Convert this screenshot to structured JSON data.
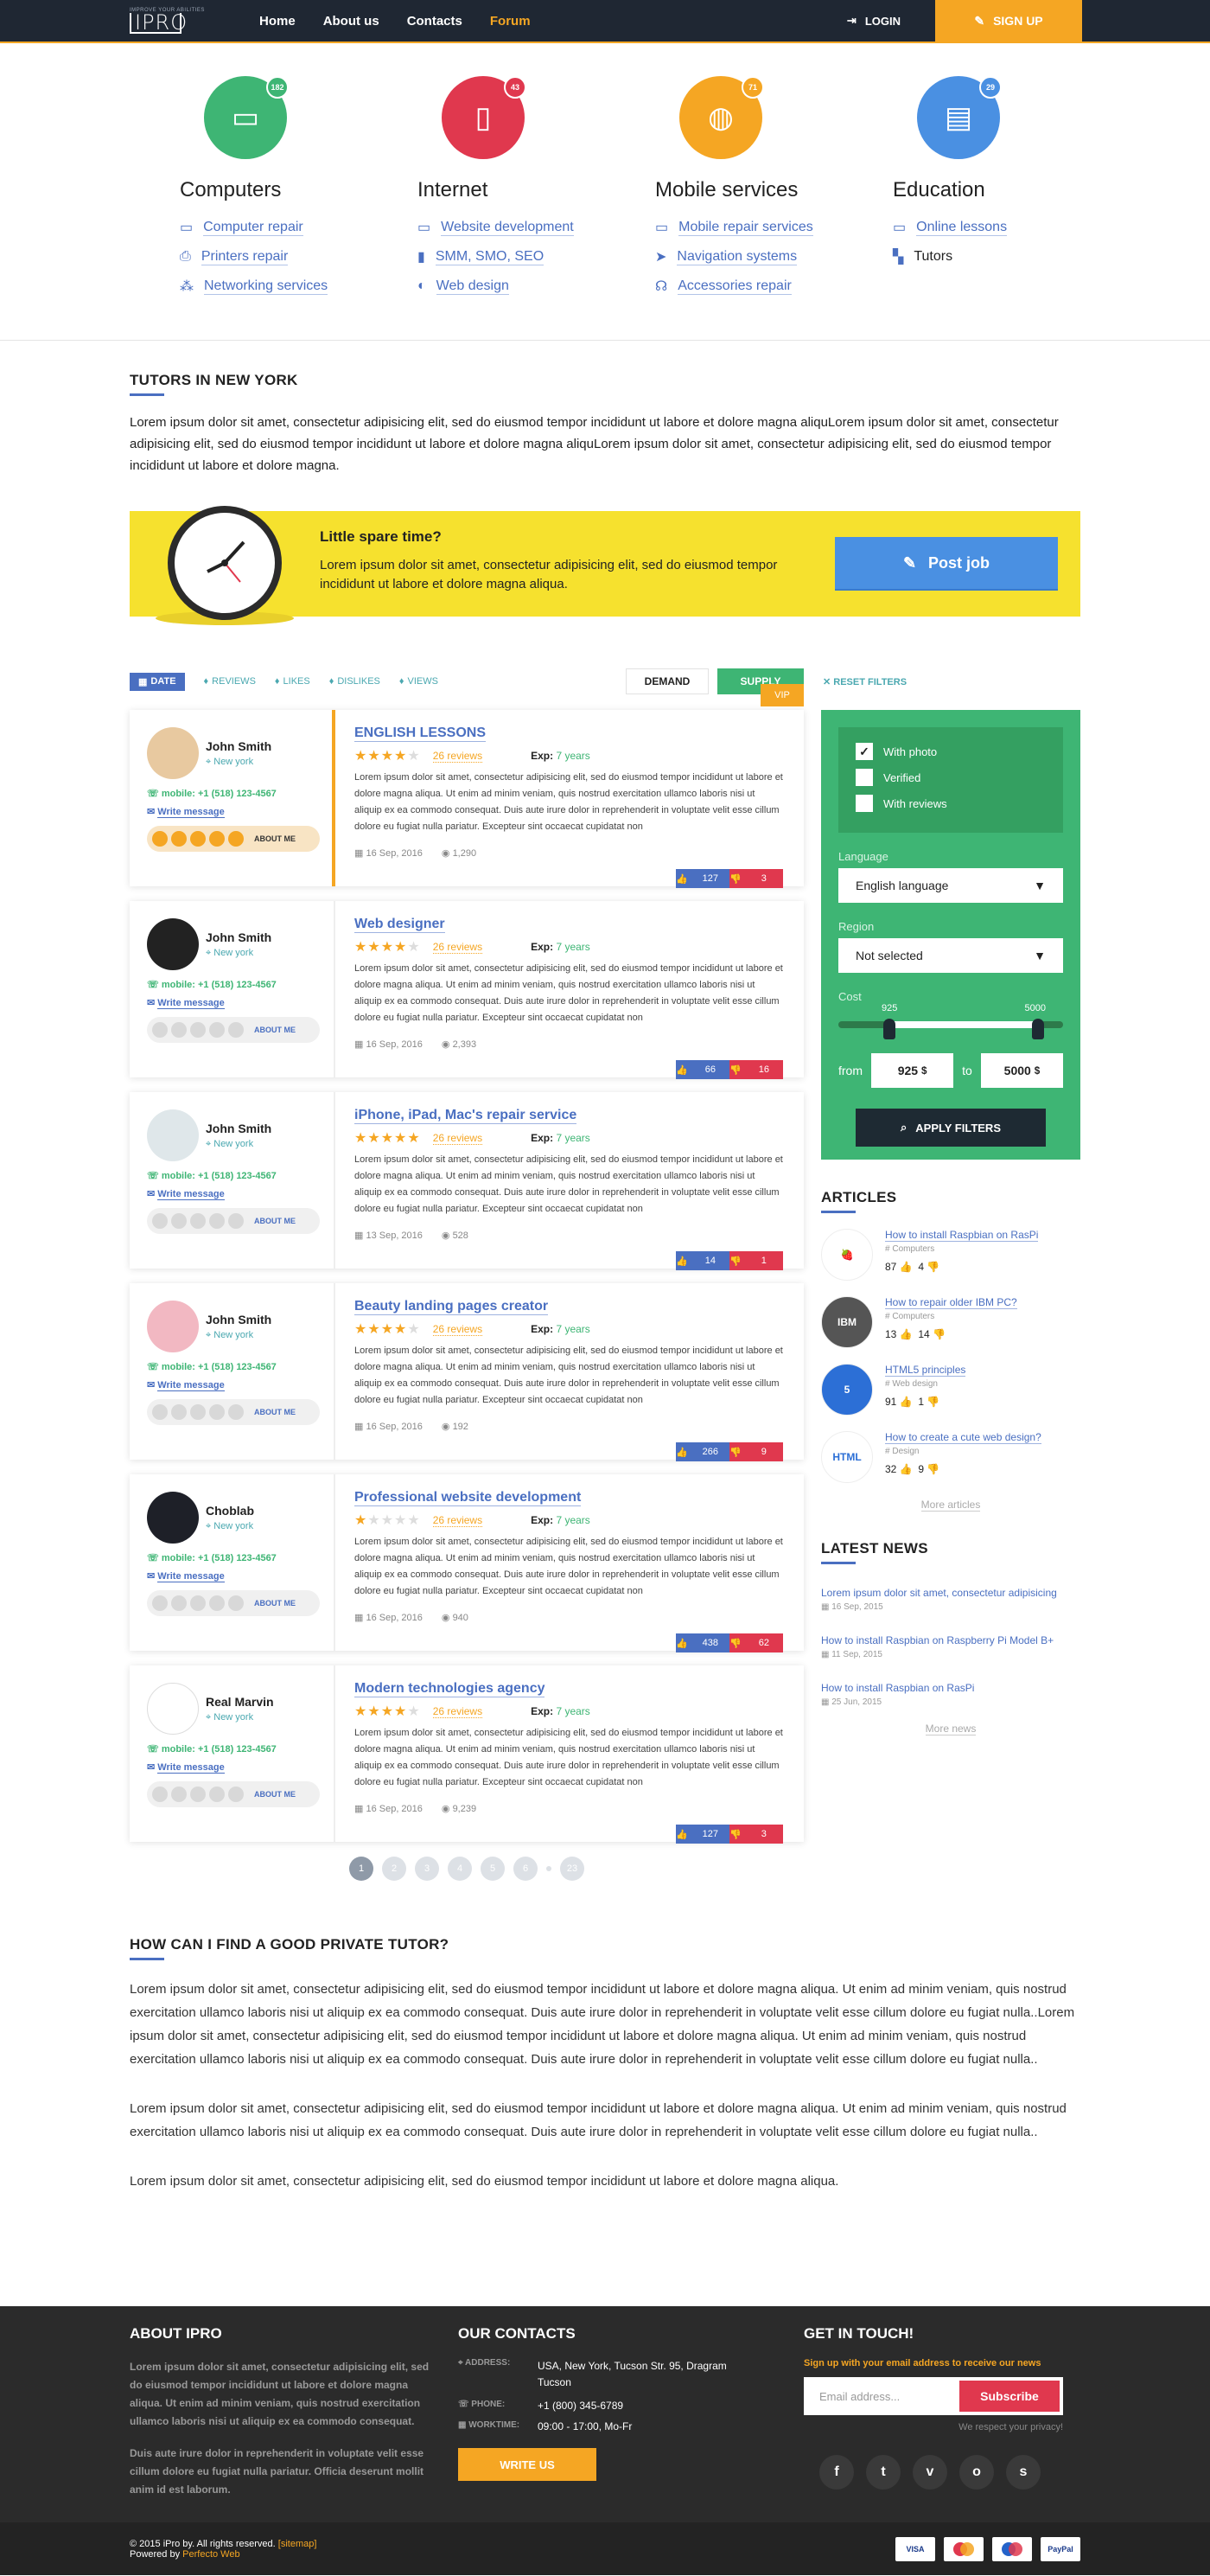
{
  "header": {
    "logo_tag": "IMPROVE YOUR ABILITIES",
    "logo": "IPRO",
    "nav": [
      "Home",
      "About us",
      "Contacts",
      "Forum"
    ],
    "login": "LOGIN",
    "signup": "SIGN UP"
  },
  "categories": [
    {
      "title": "Computers",
      "count": "182",
      "color": "#3eb574",
      "links": [
        "Computer repair",
        "Printers repair",
        "Networking services"
      ]
    },
    {
      "title": "Internet",
      "count": "43",
      "color": "#e0384e",
      "links": [
        "Website development",
        "SMM, SMO, SEO",
        "Web design"
      ]
    },
    {
      "title": "Mobile services",
      "count": "71",
      "color": "#f5a623",
      "links": [
        "Mobile repair services",
        "Navigation systems",
        "Accessories repair"
      ]
    },
    {
      "title": "Education",
      "count": "29",
      "color": "#4a90e2",
      "links": [
        "Online lessons",
        "Tutors"
      ]
    }
  ],
  "tutors": {
    "title": "TUTORS IN NEW YORK",
    "intro": "Lorem ipsum dolor sit amet, consectetur adipisicing elit, sed do eiusmod tempor incididunt ut labore et dolore magna aliquLorem ipsum dolor sit amet, consectetur adipisicing elit, sed do eiusmod tempor incididunt ut labore et dolore magna aliquLorem ipsum dolor sit amet, consectetur adipisicing elit, sed do eiusmod tempor incididunt ut labore et dolore magna."
  },
  "banner": {
    "title": "Little spare time?",
    "text": "Lorem ipsum dolor sit amet, consectetur adipisicing elit, sed do eiusmod tempor incididunt ut labore et dolore magna aliqua.",
    "button": "Post job"
  },
  "filters": {
    "tabs": [
      "DATE",
      "REVIEWS",
      "LIKES",
      "DISLIKES",
      "VIEWS"
    ],
    "demand": "DEMAND",
    "supply": "SUPPLY",
    "reset": "RESET FILTERS",
    "vip": "VIP"
  },
  "profile": {
    "mobile": "mobile: +1 (518) 123-4567",
    "write": "Write message",
    "about": "ABOUT ME",
    "exp_label": "Exp:",
    "exp": "7 years",
    "reviews": "26 reviews",
    "desc": "Lorem ipsum dolor sit amet, consectetur adipisicing elit, sed do eiusmod tempor incididunt ut labore et dolore magna aliqua. Ut enim ad minim veniam, quis nostrud exercitation ullamco laboris nisi ut aliquip ex ea commodo consequat. Duis aute irure dolor in reprehenderit in voluptate velit esse cillum dolore eu fugiat nulla pariatur. Excepteur sint occaecat cupidatat non"
  },
  "cards": [
    {
      "name": "John Smith",
      "city": "New york",
      "title": "ENGLISH LESSONS",
      "stars": 4,
      "date": "16 Sep, 2016",
      "views": "1,290",
      "up": "127",
      "down": "3"
    },
    {
      "name": "John Smith",
      "city": "New york",
      "title": "Web designer",
      "stars": 4,
      "date": "16 Sep, 2016",
      "views": "2,393",
      "up": "66",
      "down": "16"
    },
    {
      "name": "John Smith",
      "city": "New york",
      "title": "iPhone, iPad, Mac's repair service",
      "stars": 5,
      "date": "13 Sep, 2016",
      "views": "528",
      "up": "14",
      "down": "1"
    },
    {
      "name": "John Smith",
      "city": "New york",
      "title": "Beauty landing pages creator",
      "stars": 4,
      "date": "16 Sep, 2016",
      "views": "192",
      "up": "266",
      "down": "9"
    },
    {
      "name": "Choblab",
      "city": "New york",
      "title": "Professional website development",
      "stars": 1,
      "date": "16 Sep, 2016",
      "views": "940",
      "up": "438",
      "down": "62"
    },
    {
      "name": "Real Marvin",
      "city": "New york",
      "title": "Modern technologies agency",
      "stars": 4,
      "date": "16 Sep, 2016",
      "views": "9,239",
      "up": "127",
      "down": "3"
    }
  ],
  "pager": [
    "1",
    "2",
    "3",
    "4",
    "5",
    "6",
    "23"
  ],
  "sidebar": {
    "checks": [
      "With photo",
      "Verified",
      "With reviews"
    ],
    "language_label": "Language",
    "language": "English language",
    "region_label": "Region",
    "region": "Not selected",
    "cost_label": "Cost",
    "cost_min": "925",
    "cost_max": "5000",
    "from": "from",
    "to": "to",
    "from_val": "925",
    "to_val": "5000",
    "currency": "$",
    "apply": "APPLY FILTERS"
  },
  "articles": {
    "title": "ARTICLES",
    "items": [
      {
        "title": "How to install Raspbian on RasPi",
        "cat": "Computers",
        "up": "87",
        "down": "4"
      },
      {
        "title": "How to repair older IBM PC?",
        "cat": "Computers",
        "up": "13",
        "down": "14"
      },
      {
        "title": "HTML5 principles",
        "cat": "Web design",
        "up": "91",
        "down": "1"
      },
      {
        "title": "How to create a cute web design?",
        "cat": "Design",
        "up": "32",
        "down": "9"
      }
    ],
    "more": "More articles"
  },
  "news": {
    "title": "LATEST NEWS",
    "items": [
      {
        "title": "Lorem ipsum dolor sit amet, consectetur adipisicing",
        "date": "16 Sep, 2015"
      },
      {
        "title": "How to install Raspbian on Raspberry Pi Model B+",
        "date": "11 Sep, 2015"
      },
      {
        "title": "How to install Raspbian on RasPi",
        "date": "25 Jun, 2015"
      }
    ],
    "more": "More news"
  },
  "faq": {
    "title": "HOW CAN I FIND A GOOD PRIVATE TUTOR?",
    "p1": "Lorem ipsum dolor sit amet, consectetur adipisicing elit, sed do eiusmod tempor incididunt ut labore et dolore magna aliqua. Ut enim ad minim veniam, quis nostrud exercitation ullamco laboris nisi ut aliquip ex ea commodo consequat. Duis aute irure dolor in reprehenderit in voluptate velit esse cillum dolore eu fugiat nulla..Lorem ipsum dolor sit amet, consectetur adipisicing elit, sed do eiusmod tempor incididunt ut labore et dolore magna aliqua. Ut enim ad minim veniam, quis nostrud exercitation ullamco laboris nisi ut aliquip ex ea commodo consequat. Duis aute irure dolor in reprehenderit in voluptate velit esse cillum dolore eu fugiat nulla..",
    "p2": "Lorem ipsum dolor sit amet, consectetur adipisicing elit, sed do eiusmod tempor incididunt ut labore et dolore magna aliqua. Ut enim ad minim veniam, quis nostrud exercitation ullamco laboris nisi ut aliquip ex ea commodo consequat. Duis aute irure dolor in reprehenderit in voluptate velit esse cillum dolore eu fugiat nulla..",
    "p3": "Lorem ipsum dolor sit amet, consectetur adipisicing elit, sed do eiusmod tempor incididunt ut labore et dolore magna aliqua."
  },
  "footer": {
    "about_title": "ABOUT IPRO",
    "about1": "Lorem ipsum dolor sit amet, consectetur adipisicing elit, sed do eiusmod tempor incididunt ut labore et dolore magna aliqua. Ut enim ad minim veniam, quis nostrud exercitation ullamco laboris nisi ut aliquip ex ea commodo consequat.",
    "about2": "Duis aute irure dolor in reprehenderit in voluptate velit esse cillum dolore eu fugiat nulla pariatur. Officia deserunt mollit anim id est laborum.",
    "contacts_title": "OUR CONTACTS",
    "address_label": "ADDRESS:",
    "address": "USA, New York, Tucson Str. 95, Dragram Tucson",
    "phone_label": "PHONE:",
    "phone": "+1 (800) 345-6789",
    "work_label": "WORKTIME:",
    "work": "09:00 - 17:00, Mo-Fr",
    "write": "WRITE US",
    "touch_title": "GET IN TOUCH!",
    "touch_text": "Sign up with your email address to receive our news",
    "email_ph": "Email address...",
    "subscribe": "Subscribe",
    "privacy": "We respect your privacy!",
    "copyright": "© 2015 iPro by. All rights reserved.",
    "sitemap": "[sitemap]",
    "powered": "Powered by",
    "powered_by": "Perfecto Web",
    "payments": [
      "VISA",
      "",
      "",
      "PayPal"
    ]
  }
}
